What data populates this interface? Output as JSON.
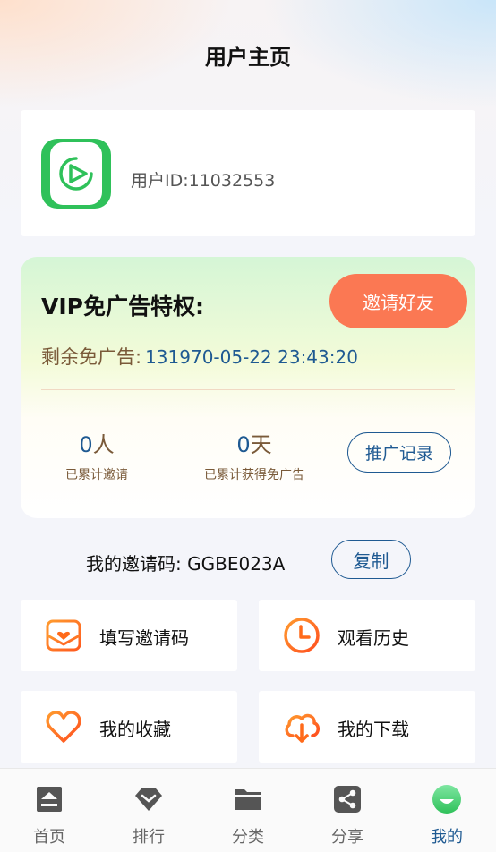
{
  "header": {
    "title": "用户主页"
  },
  "profile": {
    "user_id_text": "用户ID:11032553"
  },
  "vip": {
    "title": "VIP免广告特权:",
    "invite_button": "邀请好友",
    "remaining_label": "剩余免广告:",
    "remaining_value": "131970-05-22 23:43:20",
    "stats": [
      {
        "num": "0",
        "unit": "人",
        "label": "已累计邀请"
      },
      {
        "num": "0",
        "unit": "天",
        "label": "已累计获得免广告"
      }
    ],
    "record_button": "推广记录"
  },
  "invite_code": {
    "label": "我的邀请码:",
    "code": "GGBE023A",
    "copy_button": "复制"
  },
  "menu": [
    {
      "label": "填写邀请码",
      "icon": "envelope-heart-icon"
    },
    {
      "label": "观看历史",
      "icon": "clock-icon"
    },
    {
      "label": "我的收藏",
      "icon": "heart-icon"
    },
    {
      "label": "我的下载",
      "icon": "cloud-download-icon"
    }
  ],
  "tabs": [
    {
      "label": "首页",
      "icon": "home-icon",
      "active": false
    },
    {
      "label": "排行",
      "icon": "ranking-icon",
      "active": false
    },
    {
      "label": "分类",
      "icon": "folder-icon",
      "active": false
    },
    {
      "label": "分享",
      "icon": "share-icon",
      "active": false
    },
    {
      "label": "我的",
      "icon": "profile-icon",
      "active": true
    }
  ],
  "colors": {
    "accent_blue": "#1f5a92",
    "invite_orange": "#fb7853",
    "brand_green": "#2fc15a",
    "icon_orange": "#ff6a1a"
  }
}
